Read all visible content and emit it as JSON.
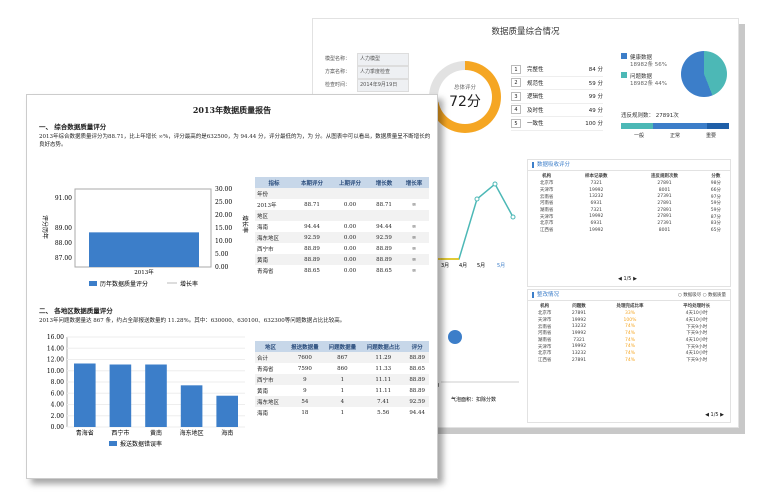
{
  "back": {
    "title": "数据质量综合情况",
    "info": [
      {
        "k": "模型名称：",
        "v": "人力模型"
      },
      {
        "k": "方案名称：",
        "v": "人力季度检查"
      },
      {
        "k": "检查时间：",
        "v": "2014年9月19日"
      }
    ],
    "score": {
      "label": "总体评分",
      "value": "72分",
      "fraction": 0.72
    },
    "metrics": [
      {
        "n": "1",
        "label": "完整性",
        "v": "84 分"
      },
      {
        "n": "2",
        "label": "规范性",
        "v": "59 分"
      },
      {
        "n": "3",
        "label": "逻辑性",
        "v": "99 分"
      },
      {
        "n": "4",
        "label": "及时性",
        "v": "49 分"
      },
      {
        "n": "5",
        "label": "一致性",
        "v": "100 分"
      }
    ],
    "pie": [
      {
        "name": "健康数据",
        "sub": "18982条   56%",
        "color": "#3c7ec9"
      },
      {
        "name": "问题数据",
        "sub": "18982条   44%",
        "color": "#4cb8b6"
      }
    ],
    "violations": "违反规则数：  27891次",
    "severity": [
      {
        "label": "一般",
        "color": "#4cb8b6"
      },
      {
        "label": "正常",
        "color": "#3c7ec9"
      },
      {
        "label": "重要",
        "color": "#1f5fa8"
      }
    ],
    "panel1": {
      "title": "数据吸收评分",
      "rows": [
        [
          "机构",
          "样本记录数",
          "违反规则次数",
          "分数"
        ],
        [
          "北京市",
          "7321",
          "27891",
          "98分"
        ],
        [
          "天津市",
          "19992",
          "8001",
          "66分"
        ],
        [
          "云南省",
          "13232",
          "27391",
          "97分"
        ],
        [
          "河南省",
          "6931",
          "27891",
          "59分"
        ],
        [
          "湖南省",
          "7321",
          "27891",
          "59分"
        ],
        [
          "天津市",
          "19992",
          "27891",
          "87分"
        ],
        [
          "北京市",
          "6931",
          "27391",
          "83分"
        ],
        [
          "江西省",
          "19992",
          "8001",
          "65分"
        ]
      ],
      "pager": "1/5"
    },
    "panel2": {
      "title": "整改情况",
      "radio1": "数据吸尽",
      "radio2": "数据质量",
      "rows": [
        [
          "机构",
          "问题数",
          "处理完成比率",
          "平均处理时长"
        ],
        [
          "北京市",
          "27891",
          "33%",
          "4天10小时"
        ],
        [
          "天津市",
          "19992",
          "100%",
          "4天10小时"
        ],
        [
          "云南省",
          "13232",
          "74%",
          "下天9小时"
        ],
        [
          "河南省",
          "19992",
          "74%",
          "下天9小时"
        ],
        [
          "湖南省",
          "7321",
          "74%",
          "4天10小时"
        ],
        [
          "天津市",
          "19992",
          "74%",
          "下天9小时"
        ],
        [
          "北京市",
          "13232",
          "74%",
          "4天10小时"
        ],
        [
          "江西省",
          "27891",
          "74%",
          "下天9小时"
        ]
      ],
      "pager": "1/5"
    },
    "line": {
      "months": [
        "3月",
        "4月",
        "5月",
        "5月"
      ],
      "footer": "气泡面积：扣除分数",
      "ytick": "40"
    }
  },
  "front": {
    "title": "2013年数据质量报告",
    "sec1": "一、   综合数据质量评分",
    "para1": "2013年综合数据质量评分为88.71，比上年增长 ∞%，评分最高的是632500，为 94.44 分，评分最低的为，为 分。从图表中可以看出，数据质量呈不断增长的良好态势。",
    "chart1": {
      "yticks": [
        "91.00",
        "89.00",
        "88.00",
        "87.00"
      ],
      "y2ticks": [
        "30.00",
        "25.00",
        "20.00",
        "15.00",
        "10.00",
        "5.00",
        "0.00"
      ],
      "ylabel": "评分历年",
      "y2label": "增长率",
      "xcat": "2013年",
      "legend1": "历年数据质量评分",
      "legend2": "增长率"
    },
    "table1": {
      "head": [
        "指标",
        "本期评分",
        "上期评分",
        "增长数",
        "增长率"
      ],
      "rows": [
        [
          "年份",
          "",
          "",
          "",
          ""
        ],
        [
          "2013年",
          "88.71",
          "0.00",
          "88.71",
          "∞"
        ],
        [
          "地区",
          "",
          "",
          "",
          ""
        ],
        [
          "海南",
          "94.44",
          "0.00",
          "94.44",
          "∞"
        ],
        [
          "海东地区",
          "92.59",
          "0.00",
          "92.59",
          "∞"
        ],
        [
          "西宁市",
          "88.89",
          "0.00",
          "88.89",
          "∞"
        ],
        [
          "黄南",
          "88.89",
          "0.00",
          "88.89",
          "∞"
        ],
        [
          "青海省",
          "88.65",
          "0.00",
          "88.65",
          "∞"
        ]
      ]
    },
    "sec2": "二、   各地区数据质量评分",
    "para2": "2013年问题数据量达 867 条，约占全部报送数量的 11.28%。其中：630000、630100、632300等问题数据占比比较高。",
    "chart2": {
      "yticks": [
        "16.00",
        "14.00",
        "12.00",
        "10.00",
        "8.00",
        "6.00",
        "4.00",
        "2.00",
        "0.00"
      ],
      "categories": [
        "青海省",
        "西宁市",
        "黄南",
        "海东地区",
        "海南"
      ],
      "values": [
        11.29,
        11.11,
        11.11,
        7.41,
        5.56
      ],
      "legend": "报送数据错误率"
    },
    "table2": {
      "head": [
        "地区",
        "报送数据量",
        "问题数据量",
        "问题数据占比",
        "评分"
      ],
      "rows": [
        [
          "合计",
          "7600",
          "867",
          "11.29",
          "88.89"
        ],
        [
          "青海省",
          "7590",
          "860",
          "11.33",
          "88.65"
        ],
        [
          "西宁市",
          "9",
          "1",
          "11.11",
          "88.89"
        ],
        [
          "黄南",
          "9",
          "1",
          "11.11",
          "88.89"
        ],
        [
          "海东地区",
          "54",
          "4",
          "7.41",
          "92.59"
        ],
        [
          "海南",
          "18",
          "1",
          "5.56",
          "94.44"
        ]
      ]
    }
  },
  "chart_data": [
    {
      "type": "bar",
      "title": "",
      "categories": [
        "青海省",
        "西宁市",
        "黄南",
        "海东地区",
        "海南"
      ],
      "series": [
        {
          "name": "报送数据错误率",
          "values": [
            11.29,
            11.11,
            11.11,
            7.41,
            5.56
          ]
        }
      ],
      "ylim": [
        0,
        16
      ]
    },
    {
      "type": "bar",
      "categories": [
        "2013年"
      ],
      "series": [
        {
          "name": "历年数据质量评分",
          "values": [
            88.71
          ]
        }
      ],
      "ylim": [
        87,
        91
      ]
    }
  ]
}
